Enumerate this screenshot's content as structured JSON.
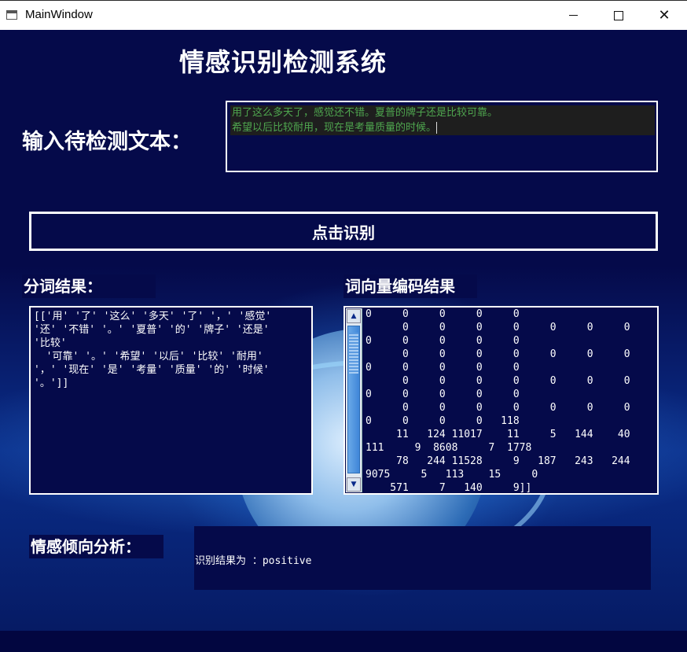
{
  "window": {
    "title": "MainWindow",
    "minimize_icon": "minimize-icon",
    "maximize_icon": "maximize-icon",
    "close_glyph": "✕"
  },
  "main": {
    "title": "情感识别检测系统",
    "input_label": "输入待检测文本：",
    "input_value": "用了这么多天了，感觉还不错。夏普的牌子还是比较可靠。\n希望以后比较耐用，现在是考量质量的时候。",
    "recognize_button": "点击识别",
    "segmentation": {
      "label": "分词结果：",
      "text": "[['用' '了' '这么' '多天' '了' '，' '感觉'\n'还' '不错' '。' '夏普' '的' '牌子' '还是'\n'比较'\n  '可靠' '。' '希望' '以后' '比较' '耐用'\n'，' '现在' '是' '考量' '质量' '的' '时候'\n'。']]"
    },
    "vector": {
      "label": "词向量编码结果",
      "text": "0     0     0     0     0\n      0     0     0     0     0     0     0     0\n0     0     0     0     0\n      0     0     0     0     0     0     0     0\n0     0     0     0     0\n      0     0     0     0     0     0     0     0\n0     0     0     0     0\n      0     0     0     0     0     0     0     0\n0     0     0     0   118\n     11   124 11017    11     5   144    40\n111     9  8608     7  1778\n     78   244 11528     9   187   243   244\n9075     5   113    15     0\n    571     7   140     9]]"
    },
    "sentiment": {
      "label": "情感倾向分析：",
      "result": "识别结果为 ：positive"
    }
  },
  "colors": {
    "background": "#050a4a",
    "input_text": "#4fa64f",
    "text": "#ffffff"
  }
}
